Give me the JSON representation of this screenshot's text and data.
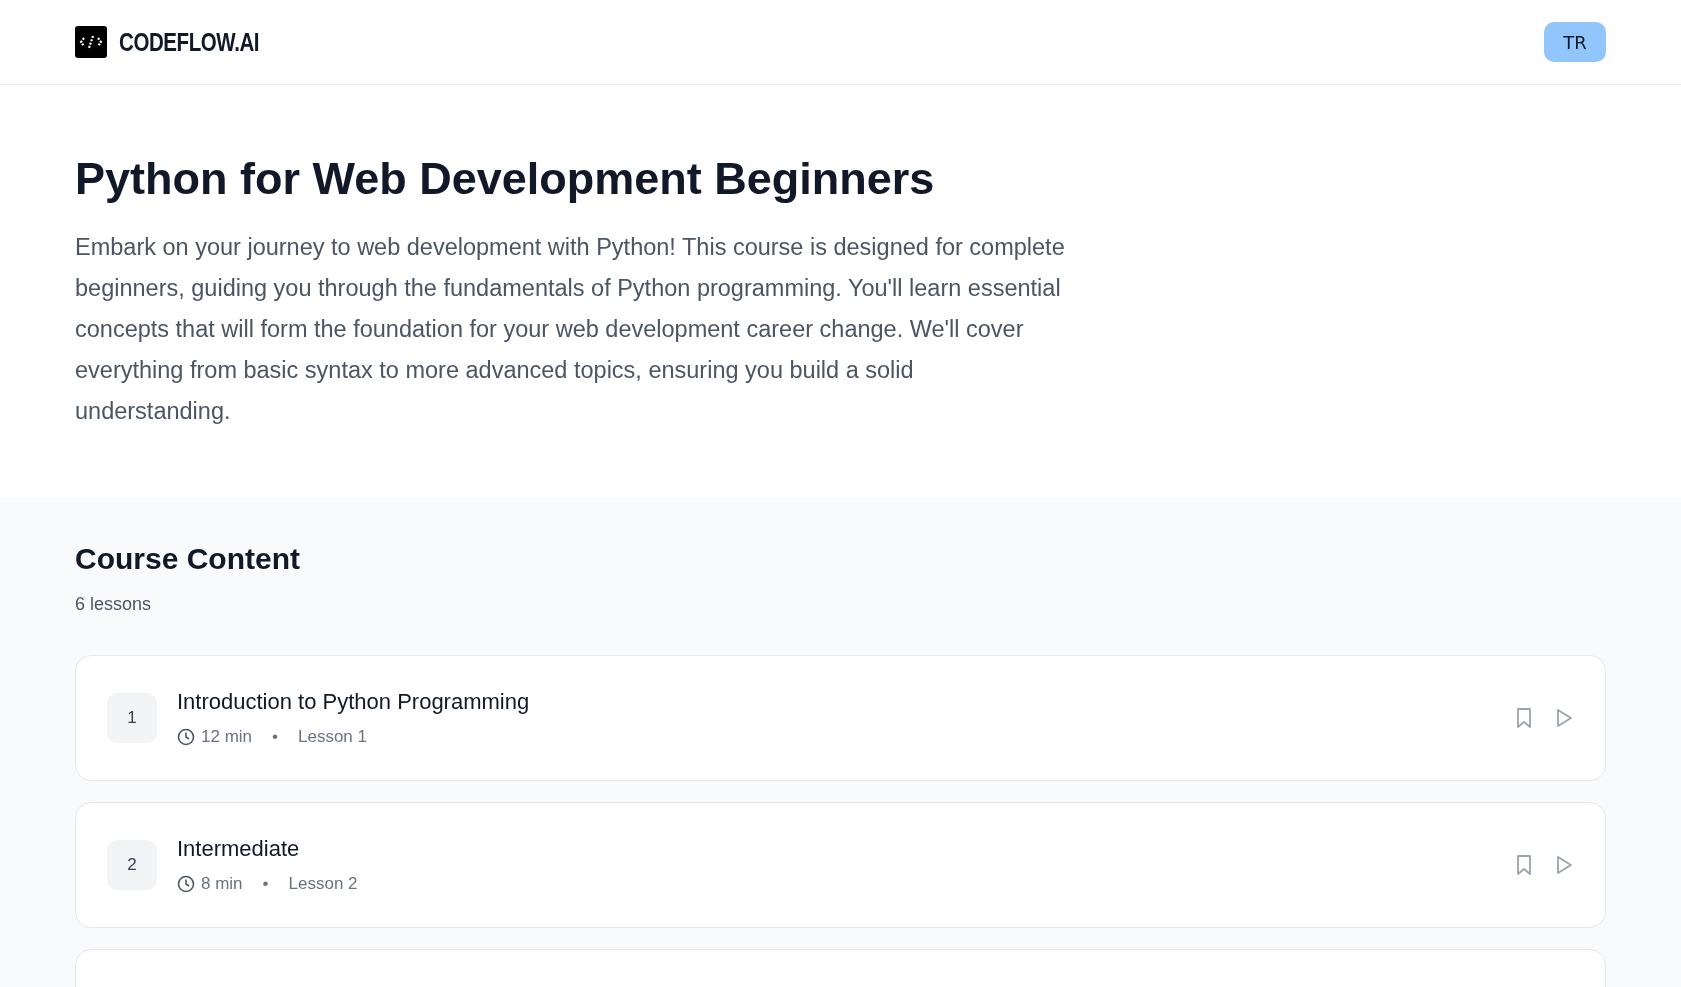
{
  "header": {
    "brand": "CODEFLOW.AI",
    "avatar": "TR"
  },
  "course": {
    "title": "Python for Web Development Beginners",
    "description": "Embark on your journey to web development with Python! This course is designed for complete beginners, guiding you through the fundamentals of Python programming. You'll learn essential concepts that will form the foundation for your web development career change. We'll cover everything from basic syntax to more advanced topics, ensuring you build a solid understanding."
  },
  "content": {
    "heading": "Course Content",
    "count": "6 lessons",
    "lessons": [
      {
        "number": "1",
        "title": "Introduction to Python Programming",
        "duration": "12 min",
        "separator": "•",
        "label": "Lesson 1"
      },
      {
        "number": "2",
        "title": "Intermediate",
        "duration": "8 min",
        "separator": "•",
        "label": "Lesson 2"
      }
    ]
  }
}
